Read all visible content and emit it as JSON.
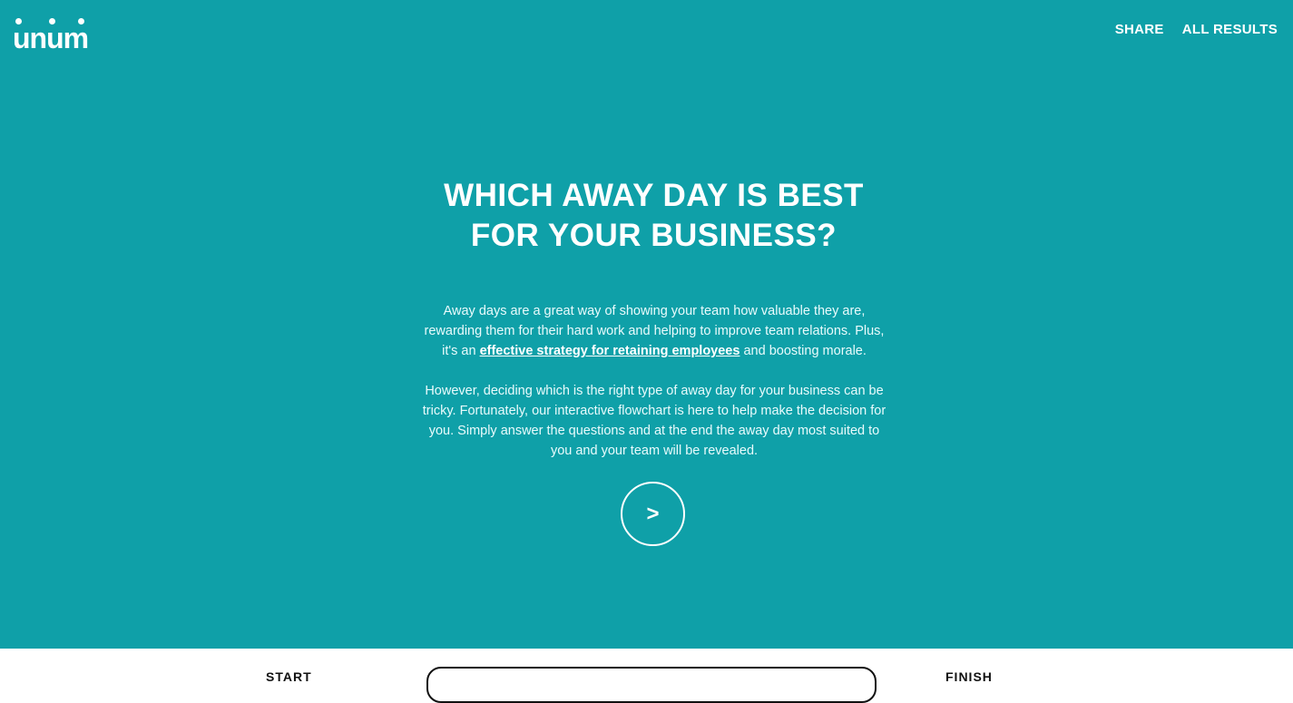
{
  "brand": {
    "logo_text": "unum"
  },
  "nav": {
    "share_label": "SHARE",
    "all_results_label": "ALL RESULTS"
  },
  "hero": {
    "title_line1": "WHICH AWAY DAY IS BEST",
    "title_line2": "FOR YOUR BUSINESS?",
    "para1_before_link": "Away days are a great way of showing your team how valuable they are, rewarding them for their hard work and helping to improve team relations. Plus, it's an ",
    "para1_link": "effective strategy for retaining employees",
    "para1_after_link": " and boosting morale.",
    "para2": "However, deciding which is the right type of away day for your business can be tricky. Fortunately, our interactive flowchart is here to help make the decision for you. Simply answer the questions and at the end the away day most suited to you and your team will be revealed.",
    "next_button_label": ">"
  },
  "progress": {
    "start_label": "START",
    "finish_label": "FINISH",
    "value_percent": 0
  },
  "colors": {
    "accent": "#0fa0a8",
    "text_light": "#ffffff",
    "text_dark": "#111111"
  }
}
